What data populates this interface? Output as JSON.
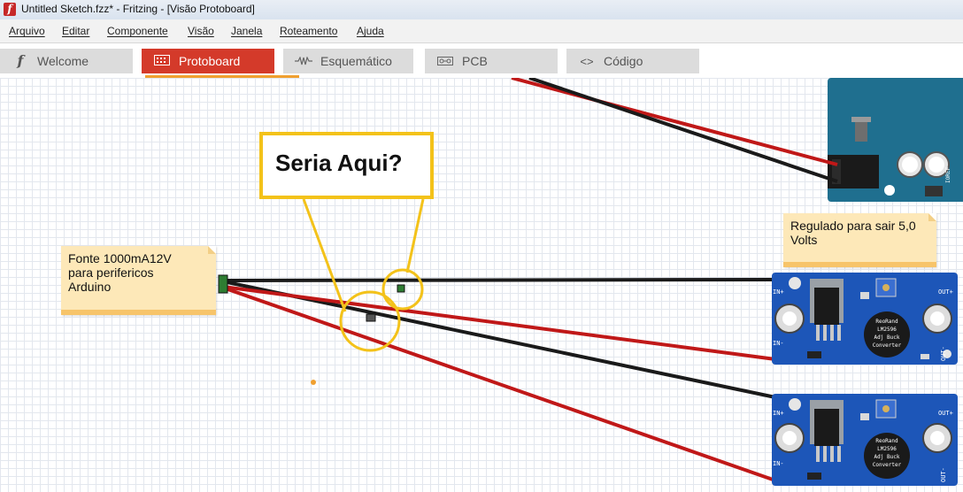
{
  "window": {
    "title": "Untitled Sketch.fzz* - Fritzing - [Visão Protoboard]",
    "icon": "fritzing-f-icon"
  },
  "menu": [
    "Arquivo",
    "Editar",
    "Componente",
    "Visão",
    "Janela",
    "Roteamento",
    "Ajuda"
  ],
  "tabs": [
    {
      "label": "Welcome",
      "icon": "fritzing-f-icon",
      "active": false
    },
    {
      "label": "Protoboard",
      "icon": "breadboard-icon",
      "active": true
    },
    {
      "label": "Esquemático",
      "icon": "resistor-icon",
      "active": false
    },
    {
      "label": "PCB",
      "icon": "pcb-icon",
      "active": false
    },
    {
      "label": "Código",
      "icon": "code-brackets-icon",
      "active": false
    }
  ],
  "notes": {
    "fonte": "Fonte 1000mA12V para perifericos Arduino",
    "regulado": "Regulado para sair  5,0 Volts"
  },
  "callout": "Seria Aqui?",
  "modules": {
    "chip_label": "ReoRand LM2596 Adj Buck Converter",
    "chip_line1": "ReoRand",
    "chip_line2": "LM2596",
    "chip_line3": "Adj Buck",
    "chip_line4": "Converter",
    "in_plus": "IN+",
    "in_minus": "IN-",
    "out_plus": "OUT+",
    "out_minus": "OUT-"
  },
  "arduino": {
    "label": "IOREF"
  },
  "colors": {
    "accent_tab": "#d43a2a",
    "wire_red": "#c01818",
    "wire_black": "#1a1a1a",
    "highlight": "#f3c21a",
    "module_blue": "#1d56b8"
  }
}
